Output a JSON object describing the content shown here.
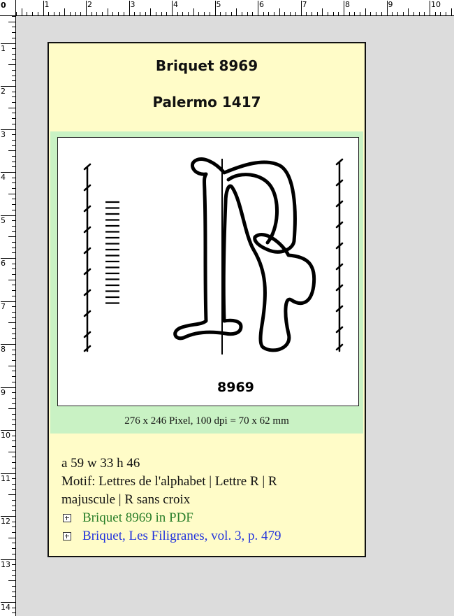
{
  "ruler": {
    "corner_label": "0",
    "top_labels": [
      "1",
      "2",
      "3",
      "4",
      "5",
      "6",
      "7",
      "8",
      "9",
      "10"
    ],
    "left_labels": [
      "1",
      "2",
      "3",
      "4",
      "5",
      "6",
      "7",
      "8",
      "9",
      "10",
      "11",
      "12",
      "13",
      "14"
    ]
  },
  "header": {
    "title": "Briquet 8969",
    "subtitle": "Palermo 1417"
  },
  "image": {
    "number_label": "8969",
    "caption": "276 x 246 Pixel, 100 dpi  =  70 x 62 mm"
  },
  "info": {
    "dims": "a 59  w 33  h 46",
    "motif_line1": "Motif: Lettres de l'alphabet | Lettre R | R",
    "motif_line2": "majuscule | R sans croix",
    "links": [
      {
        "label": "Briquet 8969 in PDF",
        "color": "#2a7f2a"
      },
      {
        "label": "Briquet, Les Filigranes, vol. 3, p. 479",
        "color": "#2233dd"
      }
    ]
  }
}
